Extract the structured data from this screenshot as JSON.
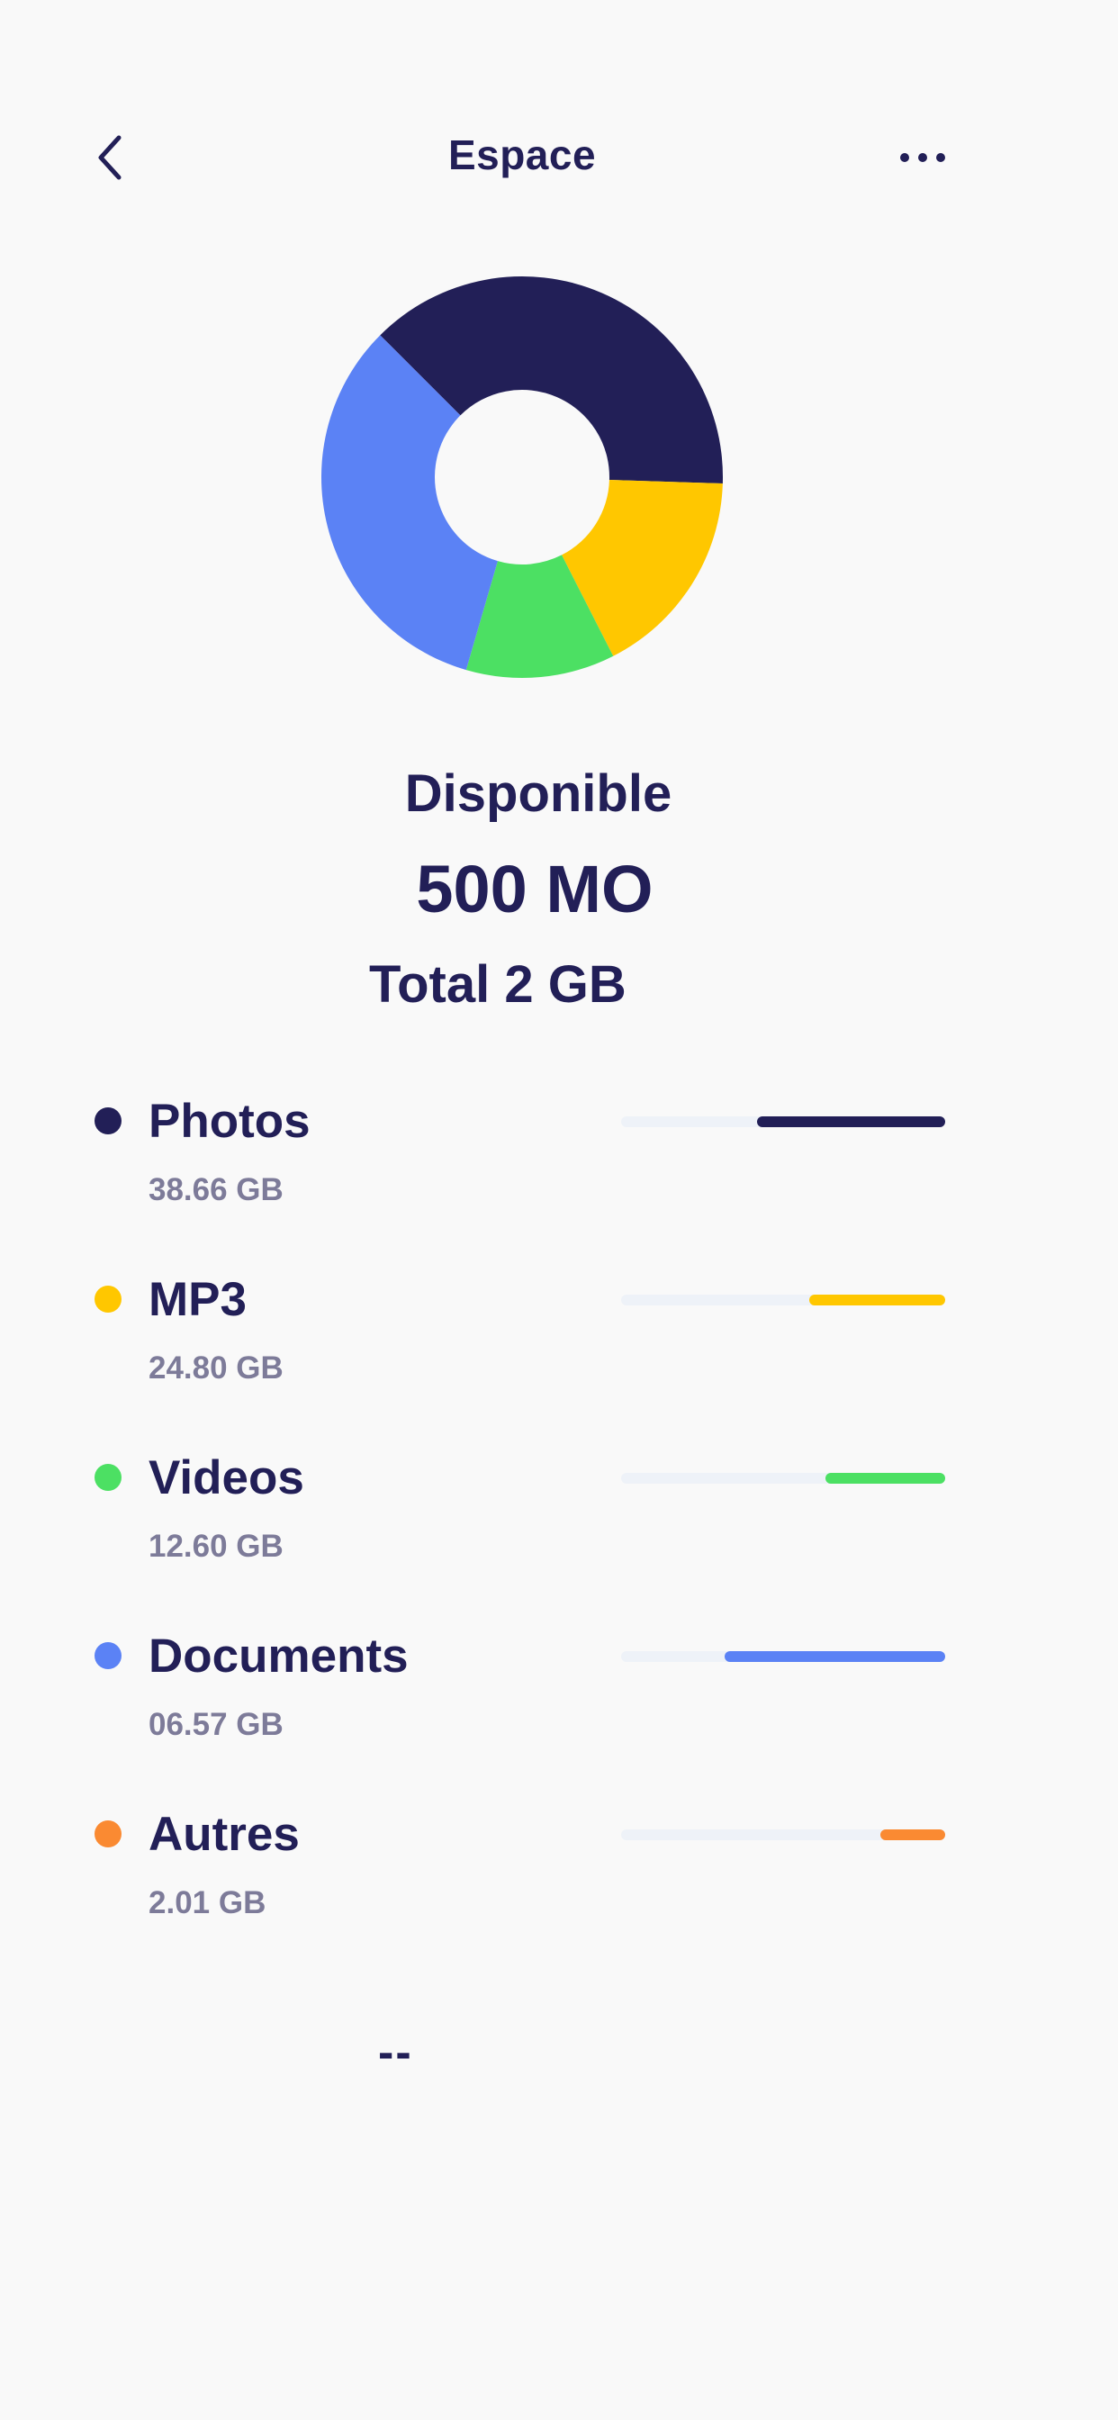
{
  "header": {
    "title": "Espace",
    "back_icon": "chevron-left-icon",
    "more_icon": "more-horizontal-icon"
  },
  "colors": {
    "navy": "#221f57",
    "yellow": "#ffc700",
    "green": "#4ce063",
    "blue": "#5b82f5",
    "orange": "#fa8a32",
    "track": "#eef2f8"
  },
  "chart_data": {
    "type": "pie",
    "categories": [
      "Photos",
      "MP3",
      "Videos",
      "Documents"
    ],
    "values": [
      38,
      17,
      12,
      33
    ],
    "colors": [
      "#221f57",
      "#ffc700",
      "#4ce063",
      "#5b82f5"
    ],
    "donut": true,
    "start_angle_deg": -45
  },
  "summary": {
    "label": "Disponible",
    "value": "500 MO",
    "total": "Total 2 GB"
  },
  "categories": [
    {
      "name": "Photos",
      "size": "38.66 GB",
      "color": "#221f57",
      "fill": 0.58
    },
    {
      "name": "MP3",
      "size": "24.80 GB",
      "color": "#ffc700",
      "fill": 0.42
    },
    {
      "name": "Videos",
      "size": "12.60 GB",
      "color": "#4ce063",
      "fill": 0.37
    },
    {
      "name": "Documents",
      "size": "06.57 GB",
      "color": "#5b82f5",
      "fill": 0.68
    },
    {
      "name": "Autres",
      "size": "2.01 GB",
      "color": "#fa8a32",
      "fill": 0.2
    }
  ],
  "footer": {
    "mark": "--"
  }
}
